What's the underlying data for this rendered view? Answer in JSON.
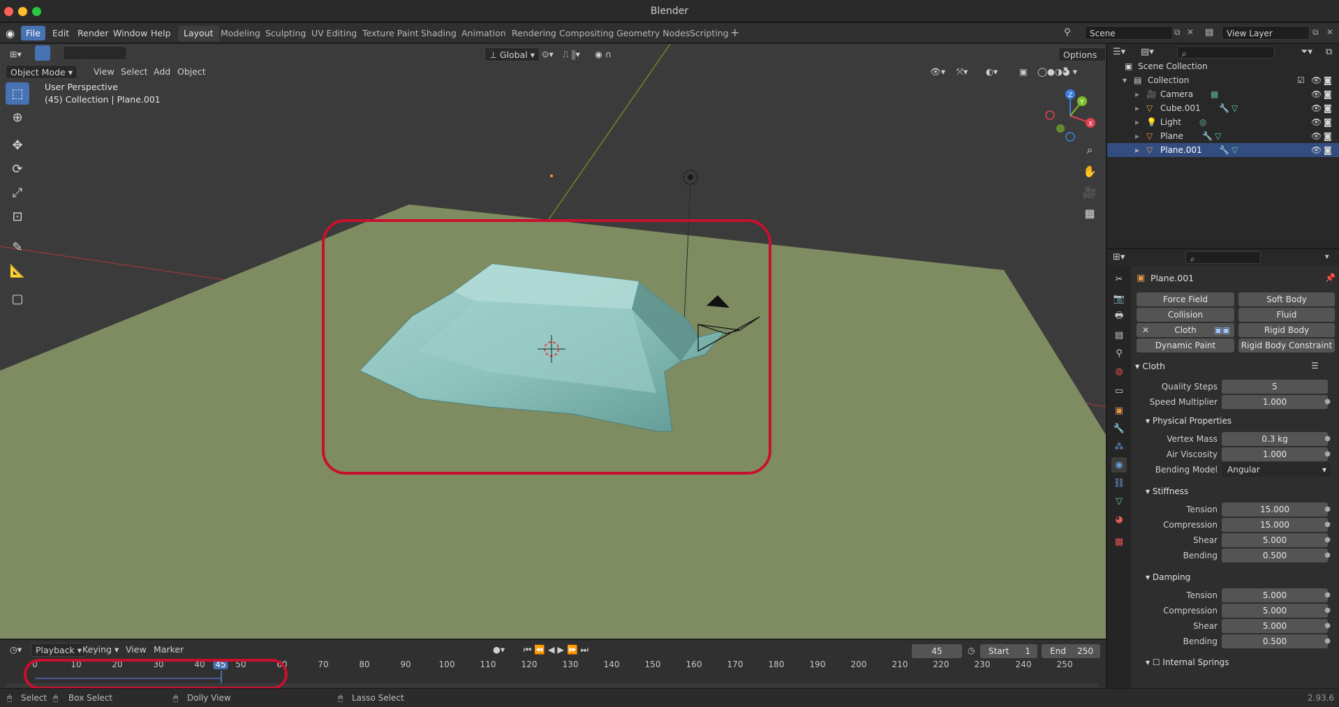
{
  "window": {
    "title": "Blender"
  },
  "menus": [
    "File",
    "Edit",
    "Render",
    "Window",
    "Help"
  ],
  "workspaces": [
    "Layout",
    "Modeling",
    "Sculpting",
    "UV Editing",
    "Texture Paint",
    "Shading",
    "Animation",
    "Rendering",
    "Compositing",
    "Geometry Nodes",
    "Scripting"
  ],
  "scene": {
    "name": "Scene",
    "view_layer": "View Layer"
  },
  "viewport": {
    "mode": "Object Mode",
    "menus": [
      "View",
      "Select",
      "Add",
      "Object"
    ],
    "transform_orientation": "Global",
    "options_label": "Options",
    "overlay_line1": "User Perspective",
    "overlay_line2": "(45) Collection | Plane.001",
    "ground_color": "#7f8c61",
    "cloth_color": "#7fb8b0",
    "highlight_color": "#c8102e"
  },
  "outliner": {
    "root": "Scene Collection",
    "collection": "Collection",
    "objects": [
      "Camera",
      "Cube.001",
      "Light",
      "Plane",
      "Plane.001"
    ]
  },
  "properties": {
    "object_name": "Plane.001",
    "physics_buttons": {
      "force_field": "Force Field",
      "soft_body": "Soft Body",
      "collision": "Collision",
      "fluid": "Fluid",
      "cloth": "Cloth",
      "rigid_body": "Rigid Body",
      "dynamic_paint": "Dynamic Paint",
      "rigid_body_constraint": "Rigid Body Constraint"
    },
    "cloth": {
      "title": "Cloth",
      "quality_steps_label": "Quality Steps",
      "quality_steps": "5",
      "speed_multiplier_label": "Speed Multiplier",
      "speed_multiplier": "1.000",
      "physical_title": "Physical Properties",
      "vertex_mass_label": "Vertex Mass",
      "vertex_mass": "0.3 kg",
      "air_viscosity_label": "Air Viscosity",
      "air_viscosity": "1.000",
      "bending_model_label": "Bending Model",
      "bending_model": "Angular",
      "stiffness_title": "Stiffness",
      "stiffness": {
        "tension": "15.000",
        "compression": "15.000",
        "shear": "5.000",
        "bending": "0.500"
      },
      "damping_title": "Damping",
      "damping": {
        "tension": "5.000",
        "compression": "5.000",
        "shear": "5.000",
        "bending": "0.500"
      },
      "labels": {
        "tension": "Tension",
        "compression": "Compression",
        "shear": "Shear",
        "bending": "Bending"
      },
      "internal_springs_title": "Internal Springs"
    }
  },
  "timeline": {
    "menus": [
      "Playback",
      "Keying",
      "View",
      "Marker"
    ],
    "current_frame": "45",
    "start_label": "Start",
    "start": "1",
    "end_label": "End",
    "end": "250",
    "ticks": [
      "0",
      "10",
      "20",
      "30",
      "40",
      "45",
      "50",
      "60",
      "70",
      "80",
      "90",
      "100",
      "110",
      "120",
      "130",
      "140",
      "150",
      "160",
      "170",
      "180",
      "190",
      "200",
      "210",
      "220",
      "230",
      "240",
      "250"
    ]
  },
  "status": {
    "select": "Select",
    "box_select": "Box Select",
    "dolly_view": "Dolly View",
    "lasso_select": "Lasso Select",
    "version": "2.93.6"
  }
}
